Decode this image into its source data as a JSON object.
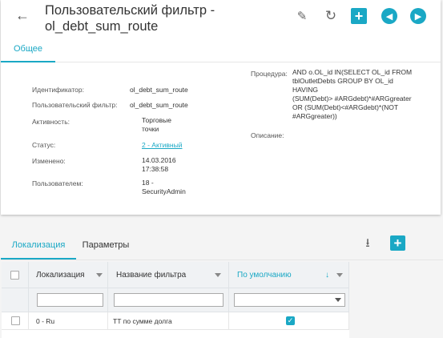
{
  "header": {
    "title": "Пользовательский фильтр - ol_debt_sum_route",
    "back_icon": "arrow-left-icon",
    "toolbar": [
      "pencil-icon",
      "refresh-icon",
      "plus-icon",
      "arrow-left-circle-icon",
      "arrow-right-circle-icon"
    ],
    "add_glyph": "+"
  },
  "tabs": {
    "general": "Общее"
  },
  "details": {
    "id_label": "Идентификатор:",
    "id_value": "ol_debt_sum_route",
    "filter_label": "Пользовательский фильтр:",
    "filter_value": "ol_debt_sum_route",
    "activity_label": "Активность:",
    "activity_line1": "Торговые",
    "activity_line2": "точки",
    "status_label": "Статус:",
    "status_value": "2 - Активный",
    "changed_label": "Изменено:",
    "changed_date": "14.03.2016",
    "changed_time": "17:38:58",
    "user_label": "Пользователем:",
    "user_line1": "18 -",
    "user_line2": "SecurityAdmin",
    "procedure_label": "Процедура:",
    "procedure_lines": [
      "AND o.OL_id IN(SELECT OL_id FROM",
      "tblOutletDebts GROUP BY OL_id",
      "HAVING",
      "(SUM(Debt)> #ARGdebt)*#ARGgreater",
      "OR (SUM(Debt)<#ARGdebt)*(NOT",
      "#ARGgreater))"
    ],
    "description_label": "Описание:"
  },
  "bottom_tabs": {
    "localization": "Локализация",
    "parameters": "Параметры"
  },
  "bottom_toolbar": {
    "upload_icon": "upload-icon",
    "add_icon": "plus-icon",
    "add_glyph": "+"
  },
  "grid": {
    "columns": [
      "Локализация",
      "Название фильтра",
      "По умолчанию"
    ],
    "sort_glyph": "↓",
    "rows": [
      {
        "localization": "0 - Ru",
        "name": "ТТ по сумме долга",
        "default": true
      }
    ]
  },
  "colors": {
    "accent": "#1aa8c5"
  }
}
